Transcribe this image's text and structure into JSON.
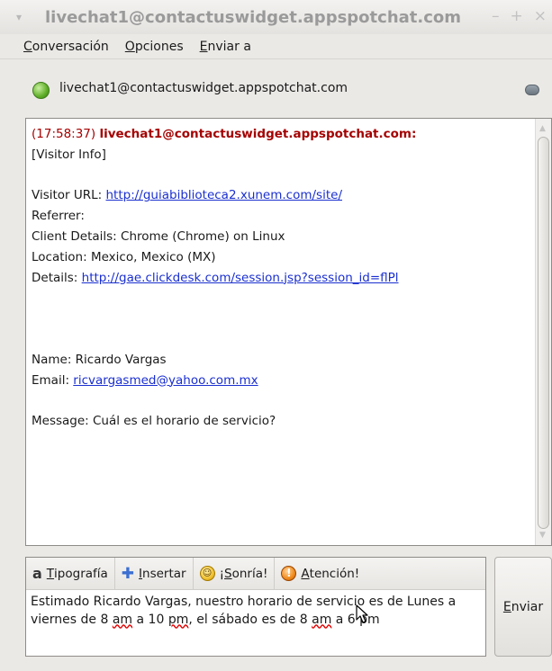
{
  "window": {
    "title": "livechat1@contactuswidget.appspotchat.com",
    "menu_arrow": "▾",
    "minimize": "–",
    "maximize": "+",
    "close": "×"
  },
  "menubar": {
    "items": [
      {
        "mnemonic": "C",
        "rest": "onversación"
      },
      {
        "mnemonic": "O",
        "rest": "pciones"
      },
      {
        "mnemonic": "E",
        "rest": "nviar a"
      }
    ]
  },
  "contact": {
    "name": "livechat1@contactuswidget.appspotchat.com",
    "status_color": "#5fae28"
  },
  "conversation": {
    "timestamp": "(17:58:37)",
    "sender": "livechat1@contactuswidget.appspotchat.com:",
    "visitor_info": "[Visitor Info]",
    "visitor_url_label": "Visitor URL: ",
    "visitor_url": "http://guiabiblioteca2.xunem.com/site/",
    "referrer": "Referrer:",
    "client_details": "Client Details: Chrome (Chrome) on Linux",
    "location": "Location: Mexico, Mexico (MX)",
    "details_label": "Details: ",
    "details_url": "http://gae.clickdesk.com/session.jsp?session_id=flPl",
    "name": "Name: Ricardo Vargas",
    "email_label": "Email: ",
    "email": "ricvargasmed@yahoo.com.mx",
    "message": "Message: Cuál es el horario de servicio?"
  },
  "toolbar": {
    "font": {
      "icon": "font-icon",
      "glyph": "a",
      "mnemonic": "T",
      "rest": "ipografía"
    },
    "insert": {
      "icon": "insert-icon",
      "glyph": "✚",
      "mnemonic": "I",
      "rest": "nsertar"
    },
    "smile": {
      "icon": "smile-icon",
      "glyph": "☺",
      "prefix": "¡",
      "mnemonic": "S",
      "rest": "onría!"
    },
    "attention": {
      "icon": "attention-icon",
      "glyph": "!",
      "mnemonic": "A",
      "rest": "tención!"
    }
  },
  "compose": {
    "part1": "Estimado Ricardo Vargas, nuestro horario de servicio es de Lunes a viernes de 8 ",
    "am1": "am",
    "part2": " a 10 ",
    "pm1": "pm",
    "part3": ", el sábado es de 8 ",
    "am2": "am",
    "part4": " a 6 pm"
  },
  "send": {
    "mnemonic": "E",
    "rest": "nviar"
  },
  "colors": {
    "timestamp": "#a40000",
    "link": "#1a2fd0",
    "spellcheck": "#e00000"
  }
}
